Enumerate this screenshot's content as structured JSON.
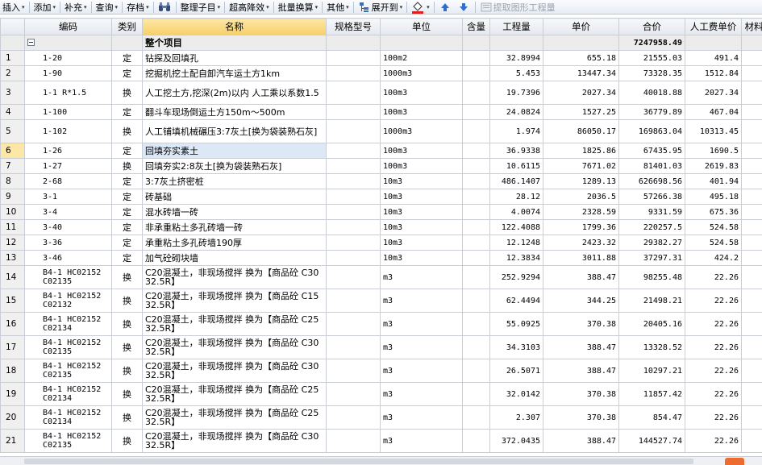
{
  "toolbar": {
    "items": [
      {
        "label": "插入",
        "caret": "▾"
      },
      {
        "label": "添加",
        "caret": "▾"
      },
      {
        "label": "补充",
        "caret": "▾"
      },
      {
        "label": "查询",
        "caret": "▾"
      },
      {
        "label": "存档",
        "caret": "▾"
      },
      {
        "label": "整理子目",
        "caret": "▾"
      },
      {
        "label": "超高降效",
        "caret": "▾"
      },
      {
        "label": "批量换算",
        "caret": "▾"
      },
      {
        "label": "其他",
        "caret": "▾"
      },
      {
        "label": "展开到",
        "caret": "▾"
      },
      {
        "label": "提取图形工程量",
        "caret": ""
      }
    ]
  },
  "columns": [
    "编码",
    "类别",
    "名称",
    "规格型号",
    "单位",
    "含量",
    "工程量",
    "单价",
    "合价",
    "人工费单价",
    "材料"
  ],
  "total_row": {
    "name": "整个项目",
    "amount": "7247958.49"
  },
  "rows": [
    {
      "n": "1",
      "code": "1-20",
      "cat": "定",
      "name": "钻探及回填孔",
      "unit": "100m2",
      "qty": "32.8994",
      "price": "655.18",
      "amount": "21555.03",
      "labor": "491.4"
    },
    {
      "n": "2",
      "code": "1-90",
      "cat": "定",
      "name": "挖掘机挖土配自卸汽车运土方1km",
      "unit": "1000m3",
      "qty": "5.453",
      "price": "13447.34",
      "amount": "73328.35",
      "labor": "1512.84"
    },
    {
      "n": "3",
      "code": "1-1 R*1.5",
      "cat": "换",
      "name": "人工挖土方,挖深(2m)以内 人工乘以系数1.5",
      "unit": "100m3",
      "qty": "19.7396",
      "price": "2027.34",
      "amount": "40018.88",
      "labor": "2027.34"
    },
    {
      "n": "4",
      "code": "1-100",
      "cat": "定",
      "name": "翻斗车现场倒运土方150m～500m",
      "unit": "100m3",
      "qty": "24.0824",
      "price": "1527.25",
      "amount": "36779.89",
      "labor": "467.04"
    },
    {
      "n": "5",
      "code": "1-102",
      "cat": "换",
      "name": "人工铺填机械碾压3:7灰土[换为袋装熟石灰]",
      "unit": "1000m3",
      "qty": "1.974",
      "price": "86050.17",
      "amount": "169863.04",
      "labor": "10313.45"
    },
    {
      "n": "6",
      "code": "1-26",
      "cat": "定",
      "name": "回填夯实素土",
      "unit": "100m3",
      "qty": "36.9338",
      "price": "1825.86",
      "amount": "67435.95",
      "labor": "1690.5"
    },
    {
      "n": "7",
      "code": "1-27",
      "cat": "换",
      "name": "回填夯实2:8灰土[换为袋装熟石灰]",
      "unit": "100m3",
      "qty": "10.6115",
      "price": "7671.02",
      "amount": "81401.03",
      "labor": "2619.83"
    },
    {
      "n": "8",
      "code": "2-68",
      "cat": "定",
      "name": "3:7灰土挤密桩",
      "unit": "10m3",
      "qty": "486.1407",
      "price": "1289.13",
      "amount": "626698.56",
      "labor": "401.94"
    },
    {
      "n": "9",
      "code": "3-1",
      "cat": "定",
      "name": "砖基础",
      "unit": "10m3",
      "qty": "28.12",
      "price": "2036.5",
      "amount": "57266.38",
      "labor": "495.18"
    },
    {
      "n": "10",
      "code": "3-4",
      "cat": "定",
      "name": "混水砖墙一砖",
      "unit": "10m3",
      "qty": "4.0074",
      "price": "2328.59",
      "amount": "9331.59",
      "labor": "675.36"
    },
    {
      "n": "11",
      "code": "3-40",
      "cat": "定",
      "name": "非承重粘土多孔砖墙一砖",
      "unit": "10m3",
      "qty": "122.4088",
      "price": "1799.36",
      "amount": "220257.5",
      "labor": "524.58"
    },
    {
      "n": "12",
      "code": "3-36",
      "cat": "定",
      "name": "承重粘土多孔砖墙190厚",
      "unit": "10m3",
      "qty": "12.1248",
      "price": "2423.32",
      "amount": "29382.27",
      "labor": "524.58"
    },
    {
      "n": "13",
      "code": "3-46",
      "cat": "定",
      "name": "加气砼砌块墙",
      "unit": "10m3",
      "qty": "12.3834",
      "price": "3011.88",
      "amount": "37297.31",
      "labor": "424.2"
    },
    {
      "n": "14",
      "code": "B4-1 HC02152 C02135",
      "cat": "换",
      "name": "C20混凝土，非现场搅拌 换为【商品砼 C30 32.5R】",
      "unit": "m3",
      "qty": "252.9294",
      "price": "388.47",
      "amount": "98255.48",
      "labor": "22.26"
    },
    {
      "n": "15",
      "code": "B4-1 HC02152 C02132",
      "cat": "换",
      "name": "C20混凝土，非现场搅拌 换为【商品砼 C15 32.5R】",
      "unit": "m3",
      "qty": "62.4494",
      "price": "344.25",
      "amount": "21498.21",
      "labor": "22.26"
    },
    {
      "n": "16",
      "code": "B4-1 HC02152 C02134",
      "cat": "换",
      "name": "C20混凝土，非现场搅拌 换为【商品砼 C25 32.5R】",
      "unit": "m3",
      "qty": "55.0925",
      "price": "370.38",
      "amount": "20405.16",
      "labor": "22.26"
    },
    {
      "n": "17",
      "code": "B4-1 HC02152 C02135",
      "cat": "换",
      "name": "C20混凝土，非现场搅拌 换为【商品砼 C30 32.5R】",
      "unit": "m3",
      "qty": "34.3103",
      "price": "388.47",
      "amount": "13328.52",
      "labor": "22.26"
    },
    {
      "n": "18",
      "code": "B4-1 HC02152 C02135",
      "cat": "换",
      "name": "C20混凝土，非现场搅拌 换为【商品砼 C30 32.5R】",
      "unit": "m3",
      "qty": "26.5071",
      "price": "388.47",
      "amount": "10297.21",
      "labor": "22.26"
    },
    {
      "n": "19",
      "code": "B4-1 HC02152 C02134",
      "cat": "换",
      "name": "C20混凝土，非现场搅拌 换为【商品砼 C25 32.5R】",
      "unit": "m3",
      "qty": "32.0142",
      "price": "370.38",
      "amount": "11857.42",
      "labor": "22.26"
    },
    {
      "n": "20",
      "code": "B4-1 HC02152 C02134",
      "cat": "换",
      "name": "C20混凝土，非现场搅拌 换为【商品砼 C25 32.5R】",
      "unit": "m3",
      "qty": "2.307",
      "price": "370.38",
      "amount": "854.47",
      "labor": "22.26"
    },
    {
      "n": "21",
      "code": "B4-1 HC02152 C02135",
      "cat": "换",
      "name": "C20混凝土，非现场搅拌 换为【商品砼 C30 32.5R】",
      "unit": "m3",
      "qty": "372.0435",
      "price": "388.47",
      "amount": "144527.74",
      "labor": "22.26"
    }
  ]
}
